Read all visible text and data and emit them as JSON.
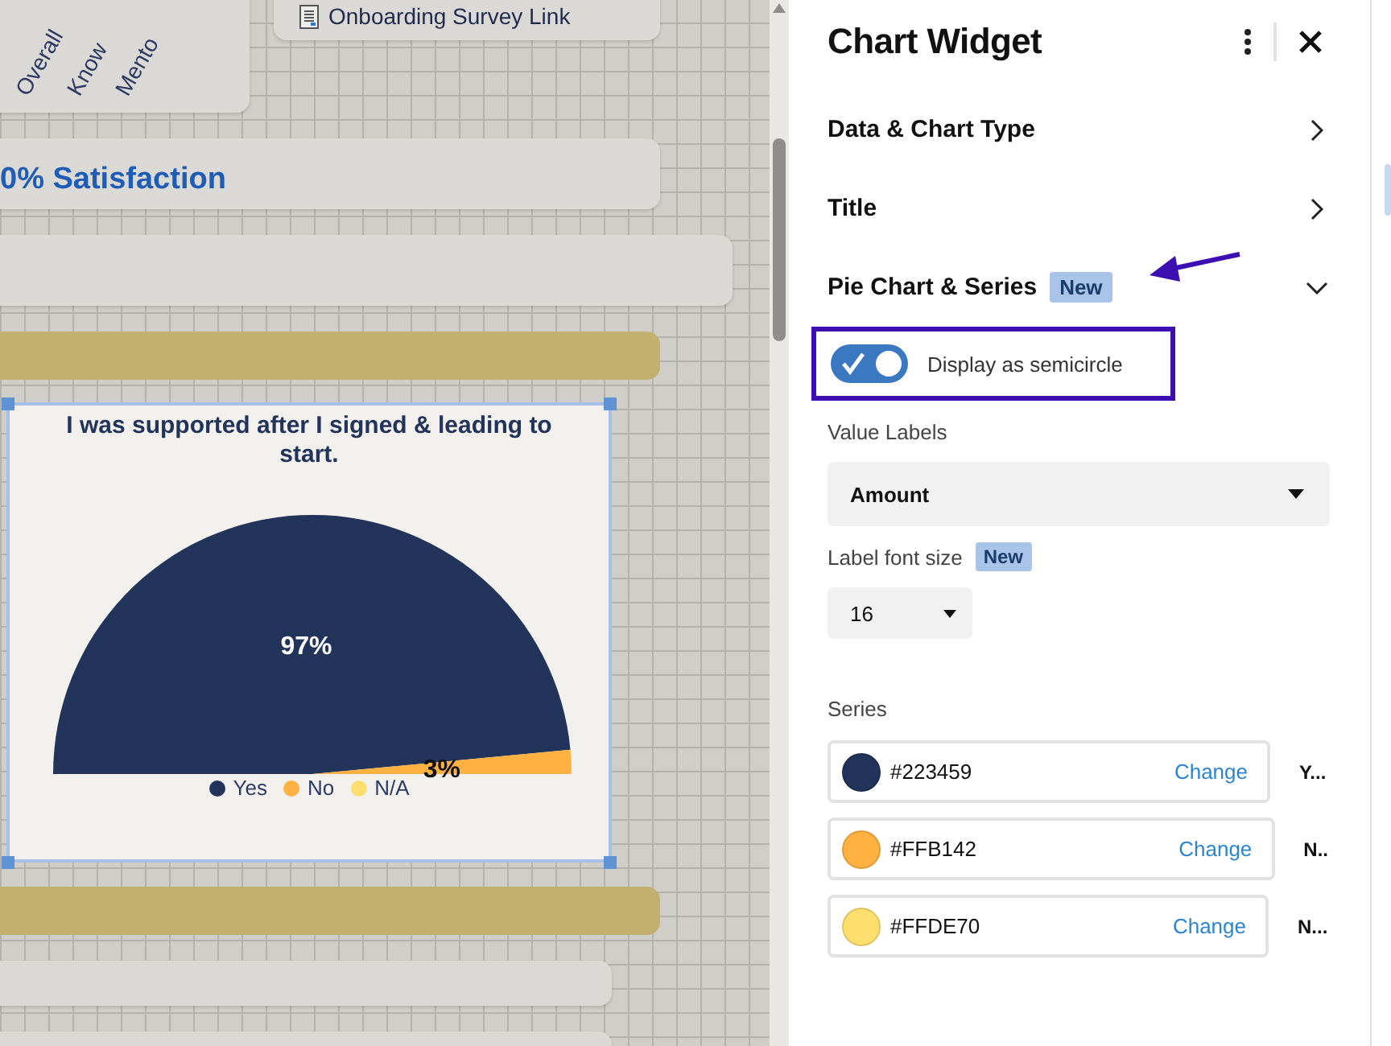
{
  "canvas": {
    "rotated_labels": [
      "Overall",
      "Know",
      "Mento"
    ],
    "link": {
      "label": "Onboarding Survey Link"
    },
    "heading": "0% Satisfaction",
    "chart_card": {
      "selected": true,
      "chart_data": {
        "type": "pie",
        "title": "I was supported after I signed & leading to start.",
        "categories": [
          "Yes",
          "No",
          "N/A"
        ],
        "values": [
          97,
          3,
          0
        ],
        "data_labels": true,
        "value_labels": [
          "97%",
          "3%",
          null
        ]
      }
    }
  },
  "panel": {
    "title": "Chart Widget",
    "sections": [
      {
        "label": "Data & Chart Type",
        "expanded": false
      },
      {
        "label": "Title",
        "expanded": false
      },
      {
        "label": "Pie Chart & Series",
        "badge": "New",
        "expanded": true
      }
    ],
    "semicircle_toggle": {
      "label": "Display as semicircle",
      "on": true
    },
    "value_labels": {
      "label": "Value Labels",
      "value": "Amount"
    },
    "label_font_size": {
      "label": "Label font size",
      "badge": "New",
      "value": "16"
    },
    "series": {
      "label": "Series",
      "items": [
        {
          "color": "#223459",
          "hex": "#223459",
          "action": "Change",
          "name": "Y..."
        },
        {
          "color": "#ffb142",
          "hex": "#FFB142",
          "action": "Change",
          "name": "N.."
        },
        {
          "color": "#ffde70",
          "hex": "#FFDE70",
          "action": "Change",
          "name": "N..."
        }
      ]
    }
  }
}
